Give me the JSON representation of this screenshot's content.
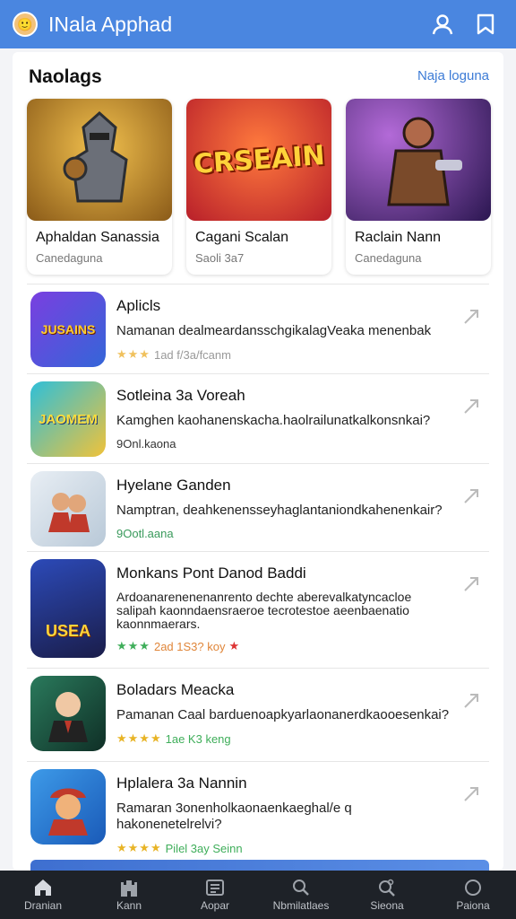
{
  "header": {
    "title": "INala Apphad",
    "logo_icon": "avatar-face-icon",
    "actions": [
      "user-icon",
      "bookmark-icon"
    ]
  },
  "featured": {
    "title": "Naolags",
    "link": "Naja loguna",
    "cards": [
      {
        "name": "Aphaldan Sanassia",
        "sub": "Canedaguna",
        "art": "knight-art",
        "color": "#b88524"
      },
      {
        "name": "Cagani Scalan",
        "sub": "Saoli 3a7",
        "art_text": "CRSEAIN",
        "color": "#c8262a"
      },
      {
        "name": "Raclain Nann",
        "sub": "Canedaguna",
        "art": "warrior-art",
        "color": "#4a2c7a"
      }
    ]
  },
  "list": [
    {
      "title": "Aplicls",
      "desc": "Namanan dealmeardansschgikalagVeaka menenbak",
      "meta": "1ad f/3a/fcanm",
      "stars": 3,
      "star_color": "#f0c15d",
      "meta_color": "#999999",
      "icon_text": "JUSAINS",
      "color": "#6a3fd4"
    },
    {
      "title": "Sotleina 3a Voreah",
      "desc": "Kamghen kaohanenskacha.haolrailunatkalkonsnkai?",
      "meta": "9Onl.kaona",
      "stars": 0,
      "star_color": "#f0c15d",
      "meta_color": "#333333",
      "icon_text": "JAOMEM",
      "color": "#2aa3c4"
    },
    {
      "title": "Hyelane Ganden",
      "desc": "Namptran, deahkenensseyhaglantaniondkahenenkair?",
      "meta": "9Ootl.aana",
      "stars": 0,
      "star_color": "#f0c15d",
      "meta_color": "#3a9a5c",
      "icon_text": "",
      "color": "#d8e3ec"
    },
    {
      "title": "Monkans Pont Danod Baddi",
      "desc": "Ardoanarenenenanrento dechte aberevalkatyncacloe salipah kaonndaensraeroe tecrotestoe aeenbaenatio kaonnmaerars.",
      "meta": "2ad 1S3? koy",
      "stars": 3,
      "star_color": "#3fae5a",
      "meta_color": "#e0863a",
      "icon_text": "USEA",
      "color": "#243a8c"
    },
    {
      "title": "Boladars Meacka",
      "desc": "Pamanan Caal barduenoapkyarlaonanerdkaooesenkai?",
      "meta": "1ae K3 keng",
      "stars": 4,
      "star_color": "#e8b426",
      "meta_color": "#3fae5a",
      "icon_text": "",
      "color": "#1f5c48"
    },
    {
      "title": "Hplalera 3a Nannin",
      "desc": "Ramaran 3onenholkaonaenkaeghal/e q hakonenetelrelvi?",
      "meta": "Pilel 3ay Seinn",
      "stars": 4,
      "star_color": "#e8b426",
      "meta_color": "#3fae5a",
      "icon_text": "",
      "color": "#2f86d6"
    }
  ],
  "bottom_nav": [
    {
      "label": "Dranian",
      "icon": "home-icon"
    },
    {
      "label": "Kann",
      "icon": "castle-icon"
    },
    {
      "label": "Aopar",
      "icon": "news-icon"
    },
    {
      "label": "Nbmilatlaes",
      "icon": "search-icon"
    },
    {
      "label": "Sieona",
      "icon": "search-gear-icon"
    },
    {
      "label": "Paiona",
      "icon": "circle-icon"
    }
  ]
}
